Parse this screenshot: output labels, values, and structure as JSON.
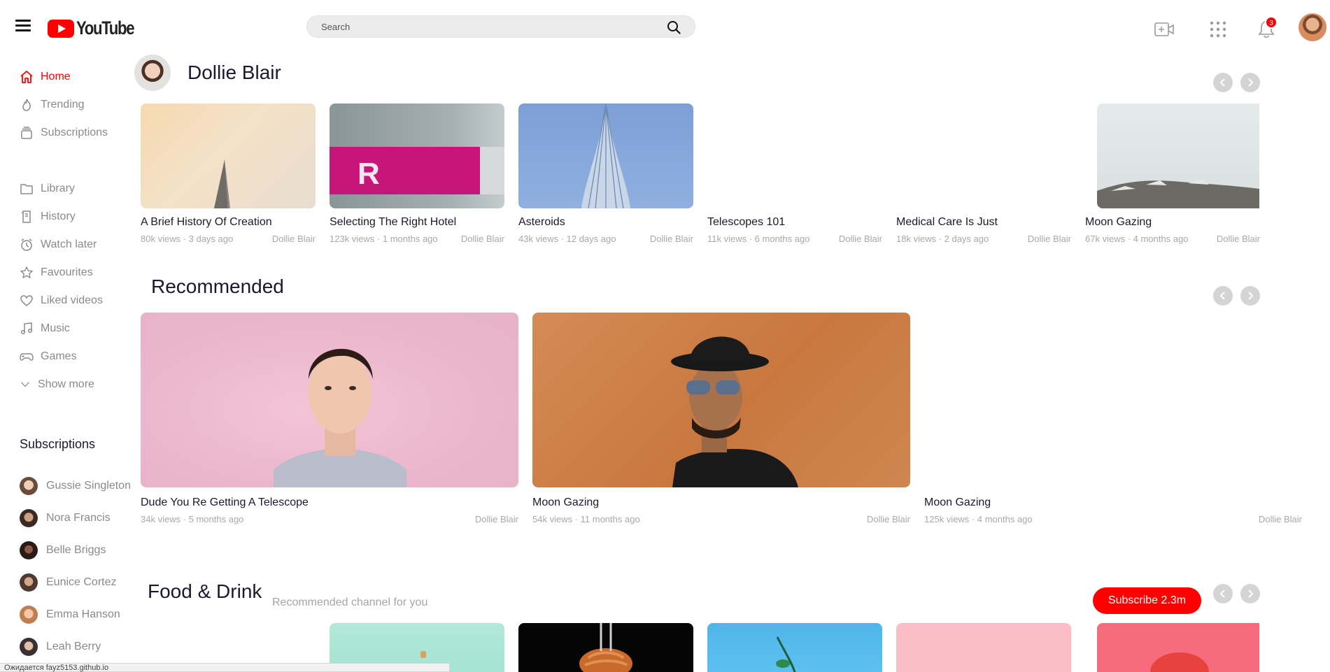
{
  "header": {
    "logo_text": "YouTube",
    "search_placeholder": "Search",
    "notification_count": "3",
    "icons": [
      "menu-icon",
      "search-icon",
      "video-camera-icon",
      "apps-icon",
      "bell-icon"
    ]
  },
  "sidebar": {
    "nav": [
      {
        "label": "Home",
        "icon": "home-icon"
      },
      {
        "label": "Trending",
        "icon": "flame-icon"
      },
      {
        "label": "Subscriptions",
        "icon": "subscriptions-icon"
      },
      {
        "label": "Library",
        "icon": "folder-icon"
      },
      {
        "label": "History",
        "icon": "history-icon"
      },
      {
        "label": "Watch later",
        "icon": "clock-icon"
      },
      {
        "label": "Favourites",
        "icon": "star-icon"
      },
      {
        "label": "Liked videos",
        "icon": "heart-icon"
      },
      {
        "label": "Music",
        "icon": "music-icon"
      },
      {
        "label": "Games",
        "icon": "gamepad-icon"
      },
      {
        "label": "Show more",
        "icon": "chevron-down-icon"
      }
    ],
    "subscriptions_title": "Subscriptions",
    "subscriptions": [
      {
        "name": "Gussie Singleton"
      },
      {
        "name": "Nora Francis"
      },
      {
        "name": "Belle Briggs"
      },
      {
        "name": "Eunice Cortez"
      },
      {
        "name": "Emma Hanson"
      },
      {
        "name": "Leah Berry"
      }
    ]
  },
  "channel_section": {
    "channel_name": "Dollie Blair",
    "videos": [
      {
        "title": "A Brief History Of Creation",
        "meta": "80k views · 3 days ago",
        "author": "Dollie Blair"
      },
      {
        "title": "Selecting The Right Hotel",
        "meta": "123k views · 1 months ago",
        "author": "Dollie Blair"
      },
      {
        "title": "Asteroids",
        "meta": "43k views · 12 days ago",
        "author": "Dollie Blair"
      },
      {
        "title": "Telescopes 101",
        "meta": "11k views · 6 months ago",
        "author": "Dollie Blair"
      },
      {
        "title": "Medical Care Is Just",
        "meta": "18k views · 2 days ago",
        "author": "Dollie Blair"
      },
      {
        "title": "Moon Gazing",
        "meta": "67k views · 4 months ago",
        "author": "Dollie Blair"
      }
    ]
  },
  "recommended": {
    "title": "Recommended",
    "videos": [
      {
        "title": "Dude You Re Getting A Telescope",
        "meta": "34k views · 5 months ago",
        "author": "Dollie Blair"
      },
      {
        "title": "Moon Gazing",
        "meta": "54k views · 11 months ago",
        "author": "Dollie Blair"
      },
      {
        "title": "Moon Gazing",
        "meta": "125k views · 4 months ago",
        "author": "Dollie Blair"
      }
    ]
  },
  "food_drink": {
    "title": "Food & Drink",
    "subtitle": "Recommended channel for you",
    "subscribe_label": "Subscribe 2.3m"
  },
  "status_bar": {
    "text": "Ожидается fayz5153.github.io"
  },
  "colors": {
    "accent": "#ff0000",
    "text": "#1a1a2e",
    "muted": "#a8a8a8"
  }
}
